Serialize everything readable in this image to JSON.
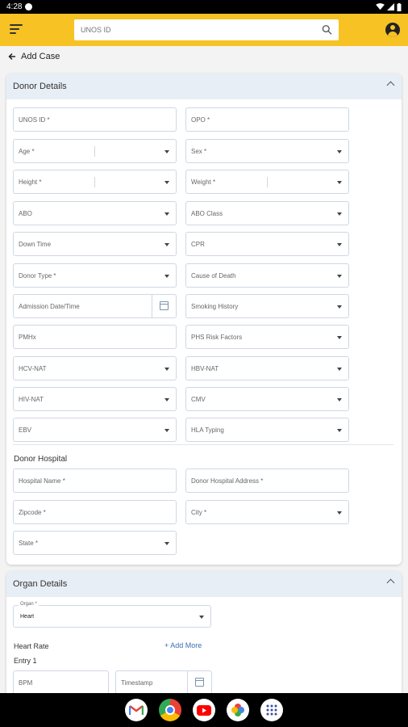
{
  "status_bar": {
    "time": "4:28"
  },
  "app_bar": {
    "search_placeholder": "UNOS ID"
  },
  "back": {
    "label": "Add Case"
  },
  "donor_details": {
    "title": "Donor Details",
    "fields": {
      "unos_id": "UNOS ID *",
      "opo": "OPO *",
      "age": "Age *",
      "sex": "Sex *",
      "height": "Height *",
      "weight": "Weight *",
      "abo": "ABO",
      "abo_class": "ABO Class",
      "down_time": "Down Time",
      "cpr": "CPR",
      "donor_type": "Donor Type *",
      "cause_of_death": "Cause of Death",
      "admission": "Admission Date/Time",
      "smoking": "Smoking History",
      "pmhx": "PMHx",
      "phs": "PHS Risk Factors",
      "hcv": "HCV-NAT",
      "hbv": "HBV-NAT",
      "hiv": "HIV-NAT",
      "cmv": "CMV",
      "ebv": "EBV",
      "hla": "HLA Typing"
    },
    "hospital": {
      "title": "Donor Hospital",
      "hospital_name": "Hospital Name *",
      "hospital_address": "Donor Hospital Address *",
      "zipcode": "Zipcode *",
      "city": "City *",
      "state": "State *"
    }
  },
  "organ_details": {
    "title": "Organ Details",
    "organ_label": "Organ *",
    "organ_value": "Heart",
    "heart_rate": "Heart Rate",
    "add_more": "+ Add More",
    "entry": "Entry 1",
    "bpm": "BPM",
    "timestamp": "Timestamp"
  },
  "colors": {
    "accent": "#f6c224",
    "link": "#3b6fb6",
    "section_head": "#e8eef5"
  },
  "nav_apps": [
    "gmail-icon",
    "chrome-icon",
    "youtube-icon",
    "photos-icon",
    "apps-icon"
  ]
}
